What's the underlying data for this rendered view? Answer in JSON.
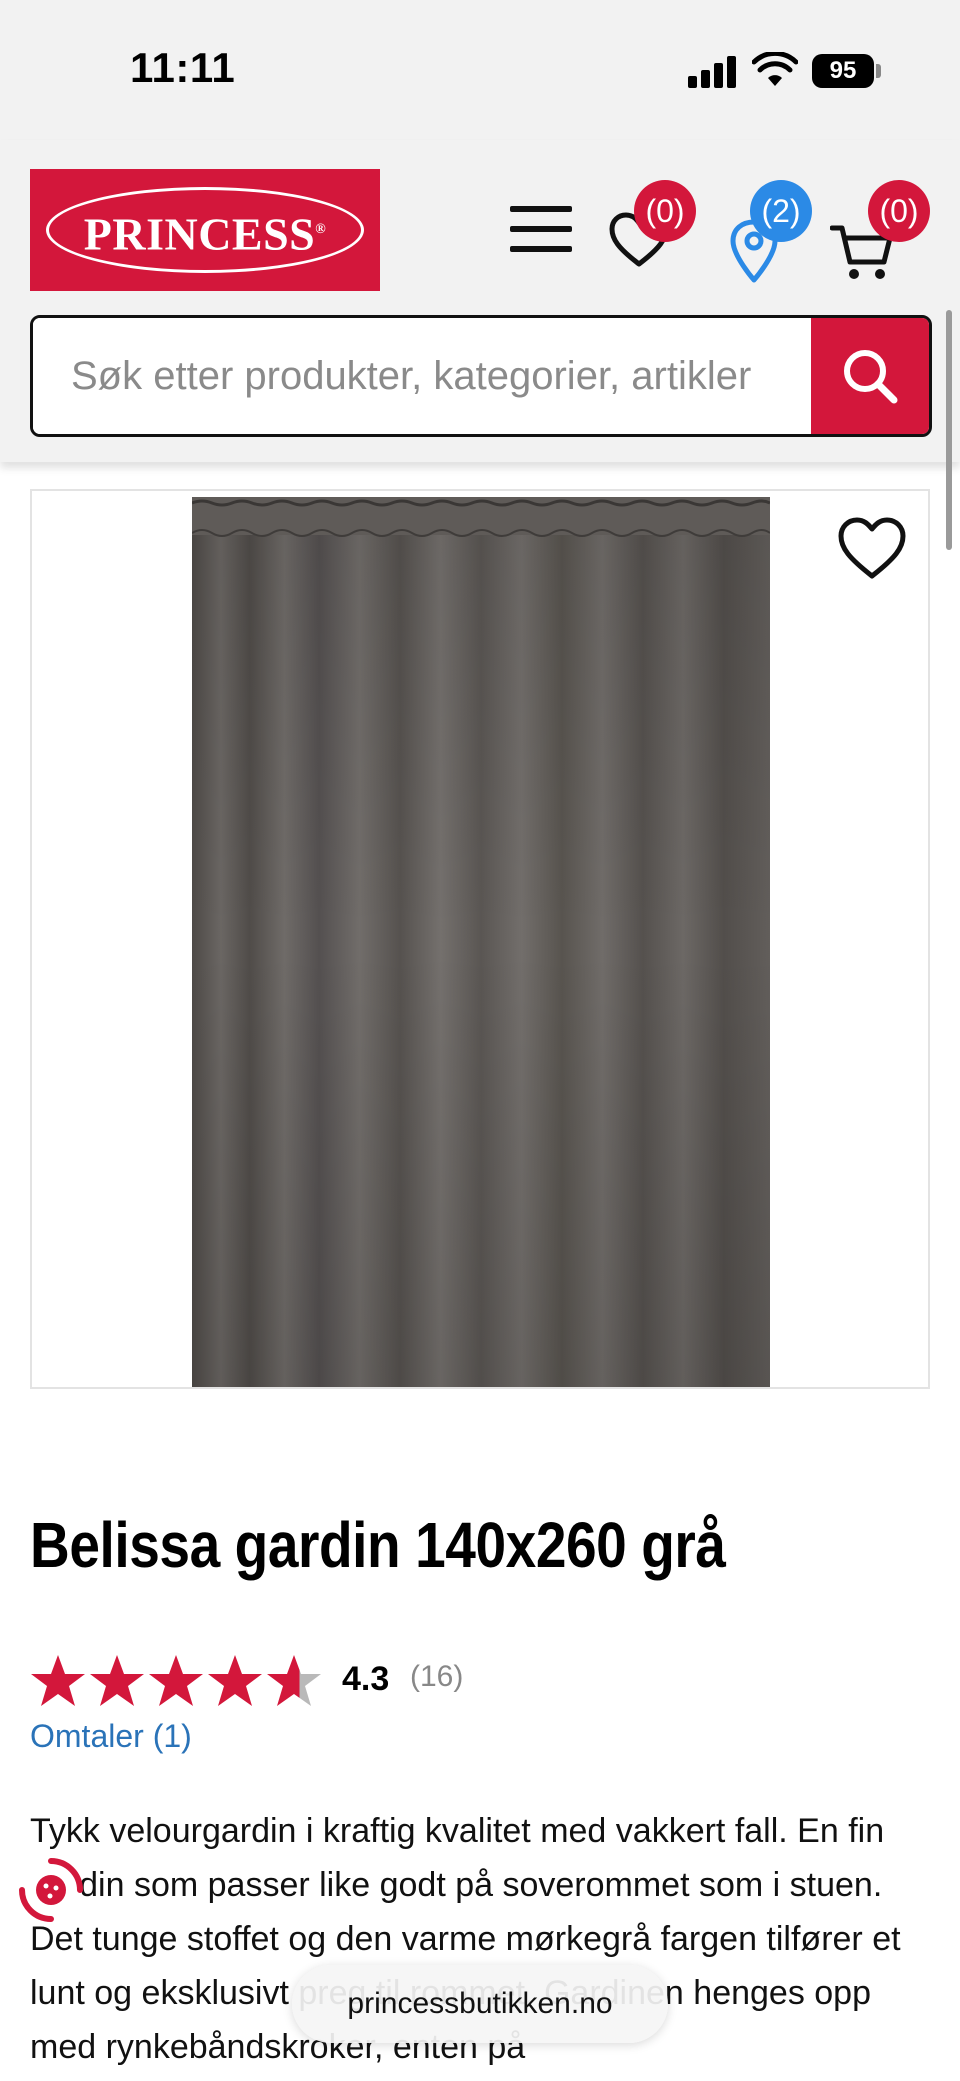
{
  "status_bar": {
    "time": "11:11",
    "battery": "95",
    "signal_icon": "cellular-signal-icon",
    "wifi_icon": "wifi-icon"
  },
  "header": {
    "logo_text": "PRINCESS",
    "logo_mark": "®",
    "menu_icon": "hamburger-menu-icon",
    "wishlist_badge": "(0)",
    "stores_badge": "(2)",
    "cart_badge": "(0)",
    "brand_color": "#d3173b",
    "stores_color": "#2b8ae6"
  },
  "search": {
    "placeholder": "Søk etter produkter, kategorier, artikler",
    "button_icon": "search-icon"
  },
  "product": {
    "image_alt": "Belissa gardin 140x260 grå",
    "title": "Belissa gardin 140x260 grå",
    "rating": "4.3",
    "rating_fraction": 0.86,
    "rating_count": "(16)",
    "reviews_link": "Omtaler (1)",
    "description": "Tykk velourgardin i kraftig kvalitet med vakkert fall. En fin gardin som passer like godt på soverommet som i stuen. Det tunge stoffet og den varme mørkegrå fargen tilfører et lunt og eksklusivt preg til rommet. Gardinen henges opp med rynkebåndskroker, enten på"
  },
  "browser": {
    "url": "princessbutikken.no"
  }
}
